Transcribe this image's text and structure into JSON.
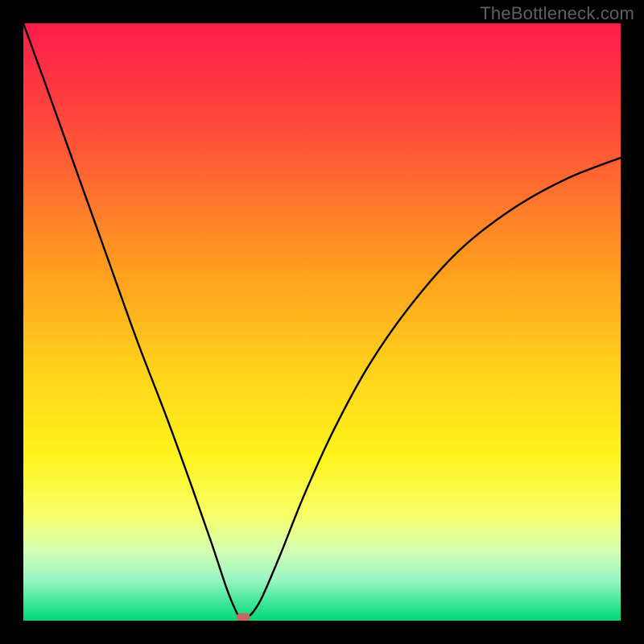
{
  "watermark": "TheBottleneck.com",
  "chart_data": {
    "type": "line",
    "title": "",
    "xlabel": "",
    "ylabel": "",
    "xlim": [
      0,
      100
    ],
    "ylim": [
      0,
      100
    ],
    "gradient_stops": [
      {
        "offset": 0.0,
        "color": "#ff1b4b"
      },
      {
        "offset": 0.18,
        "color": "#ff4d3a"
      },
      {
        "offset": 0.4,
        "color": "#ff9a1f"
      },
      {
        "offset": 0.58,
        "color": "#ffd21a"
      },
      {
        "offset": 0.72,
        "color": "#fff31a"
      },
      {
        "offset": 0.82,
        "color": "#f8ff66"
      },
      {
        "offset": 0.88,
        "color": "#d7ffb0"
      },
      {
        "offset": 0.93,
        "color": "#9cf5c4"
      },
      {
        "offset": 0.97,
        "color": "#3fe798"
      },
      {
        "offset": 1.0,
        "color": "#00d67a"
      }
    ],
    "curve_points": [
      {
        "x": 0.0,
        "y": 100.0
      },
      {
        "x": 4.0,
        "y": 89.0
      },
      {
        "x": 9.0,
        "y": 75.0
      },
      {
        "x": 14.0,
        "y": 61.0
      },
      {
        "x": 19.0,
        "y": 47.0
      },
      {
        "x": 24.0,
        "y": 34.0
      },
      {
        "x": 28.0,
        "y": 23.0
      },
      {
        "x": 31.5,
        "y": 13.0
      },
      {
        "x": 34.0,
        "y": 5.5
      },
      {
        "x": 35.5,
        "y": 1.8
      },
      {
        "x": 36.3,
        "y": 0.6
      },
      {
        "x": 37.5,
        "y": 0.6
      },
      {
        "x": 38.5,
        "y": 1.5
      },
      {
        "x": 40.0,
        "y": 4.0
      },
      {
        "x": 43.0,
        "y": 11.0
      },
      {
        "x": 47.0,
        "y": 21.0
      },
      {
        "x": 52.0,
        "y": 32.0
      },
      {
        "x": 58.0,
        "y": 43.0
      },
      {
        "x": 65.0,
        "y": 53.0
      },
      {
        "x": 73.0,
        "y": 62.0
      },
      {
        "x": 82.0,
        "y": 69.0
      },
      {
        "x": 91.0,
        "y": 74.0
      },
      {
        "x": 100.0,
        "y": 77.5
      }
    ],
    "marker": {
      "x": 36.8,
      "y": 0.6,
      "color": "#c46a5d"
    }
  }
}
